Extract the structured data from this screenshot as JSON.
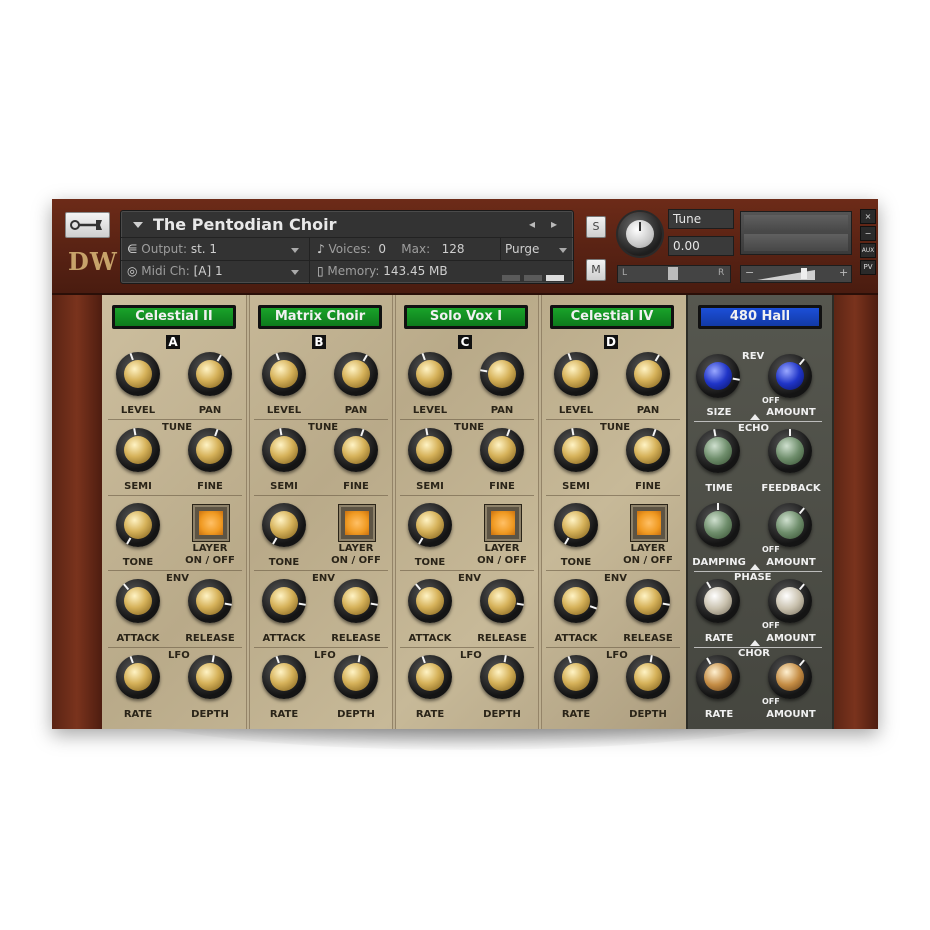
{
  "header": {
    "logo_text": "DW",
    "instrument_name": "The Pentodian Choir",
    "nav_prev": "◂",
    "nav_next": "▸",
    "output_label": "Output:",
    "output_value": "st. 1",
    "midi_label": "Midi Ch:",
    "midi_value": "[A]  1",
    "voices_label": "Voices:",
    "voices_value": "0",
    "max_label": "Max:",
    "max_value": "128",
    "memory_label": "Memory:",
    "memory_value": "143.45 MB",
    "purge_label": "Purge",
    "solo_label": "S",
    "mute_label": "M",
    "tune_label": "Tune",
    "tune_value": "0.00",
    "pan_left": "L",
    "pan_right": "R",
    "vol_minus": "−",
    "vol_plus": "+",
    "close": "×",
    "minimize": "−",
    "aux": "AUX",
    "pv": "PV"
  },
  "channels": [
    {
      "preset": "Celestial II",
      "letter": "A"
    },
    {
      "preset": "Matrix Choir",
      "letter": "B"
    },
    {
      "preset": "Solo Vox I",
      "letter": "C"
    },
    {
      "preset": "Celestial IV",
      "letter": "D"
    }
  ],
  "channel_labels": {
    "level": "LEVEL",
    "pan": "PAN",
    "tune": "TUNE",
    "semi": "SEMI",
    "fine": "FINE",
    "tone": "TONE",
    "layer": "LAYER",
    "onoff": "ON / OFF",
    "env": "ENV",
    "attack": "ATTACK",
    "release": "RELEASE",
    "lfo": "LFO",
    "rate": "RATE",
    "depth": "DEPTH"
  },
  "fx": {
    "preset": "480 Hall",
    "rev": "REV",
    "size": "SIZE",
    "amount": "AMOUNT",
    "off": "OFF",
    "echo": "ECHO",
    "time": "TIME",
    "feedback": "FEEDBACK",
    "damping": "DAMPING",
    "phase": "PHASE",
    "rate": "RATE",
    "chor": "CHOR"
  },
  "colors": {
    "preset_green": "#1aa32a",
    "preset_blue": "#1c4fd8",
    "wood": "#6d2b18",
    "panel": "#c4b594",
    "fx_panel": "#4e4f47"
  }
}
